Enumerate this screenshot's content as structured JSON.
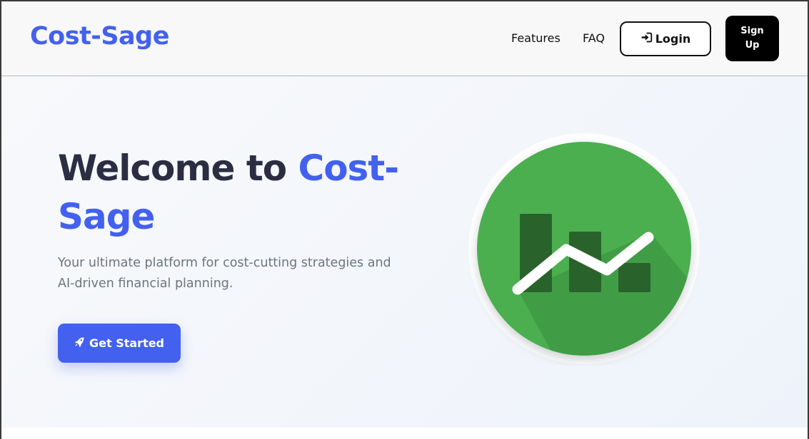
{
  "brand": {
    "name": "Cost-Sage",
    "accent_color": "#4361ee"
  },
  "nav": {
    "links": [
      {
        "label": "Features"
      },
      {
        "label": "FAQ"
      }
    ],
    "login_label": "Login",
    "login_icon": "sign-in-icon",
    "signup_label": "Sign Up"
  },
  "hero": {
    "title_prefix": "Welcome to",
    "title_accent": "Cost-Sage",
    "subtitle": "Your ultimate platform for cost-cutting strategies and AI-driven financial planning.",
    "cta_label": "Get Started",
    "cta_icon": "rocket-icon",
    "illustration_icon": "chart-growth-icon",
    "illustration_color": "#4caf50"
  }
}
